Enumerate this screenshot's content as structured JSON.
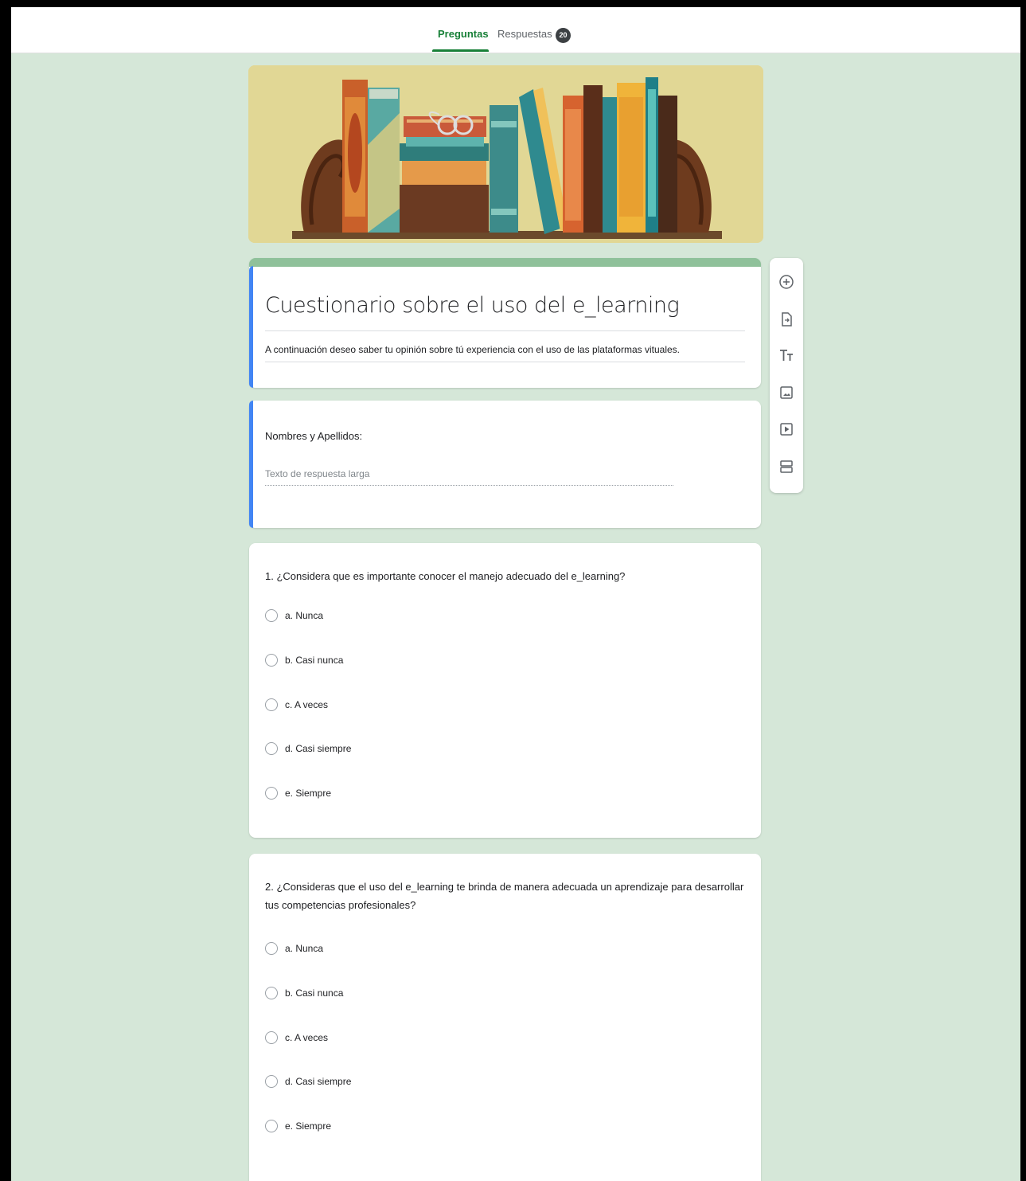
{
  "tabs": {
    "preguntas": "Preguntas",
    "respuestas": "Respuestas",
    "respuestas_count": "20"
  },
  "form": {
    "title": "Cuestionario sobre el uso del e_learning",
    "description": "A continuación deseo saber tu opinión sobre tú experiencia con el uso de las plataformas vituales."
  },
  "name_question": {
    "label": "Nombres y Apellidos:",
    "placeholder": "Texto de respuesta larga"
  },
  "questions": [
    {
      "text": "1.    ¿Considera que es importante conocer el manejo adecuado del e_learning?",
      "options": [
        "a. Nunca",
        "b. Casi nunca",
        "c. A veces",
        "d. Casi siempre",
        "e. Siempre"
      ]
    },
    {
      "text": "2.    ¿Consideras que el uso del e_learning te brinda de manera adecuada un aprendizaje para desarrollar tus competencias profesionales?",
      "options": [
        "a. Nunca",
        "b. Casi nunca",
        "c. A veces",
        "d. Casi siempre",
        "e. Siempre"
      ]
    }
  ],
  "sidebar_tools": [
    "add-question-icon",
    "import-questions-icon",
    "add-title-icon",
    "add-image-icon",
    "add-video-icon",
    "add-section-icon"
  ],
  "colors": {
    "accent": "#188038",
    "background": "#d5e7d8",
    "header_bar": "#8fc19a",
    "active_card": "#4285f4"
  }
}
